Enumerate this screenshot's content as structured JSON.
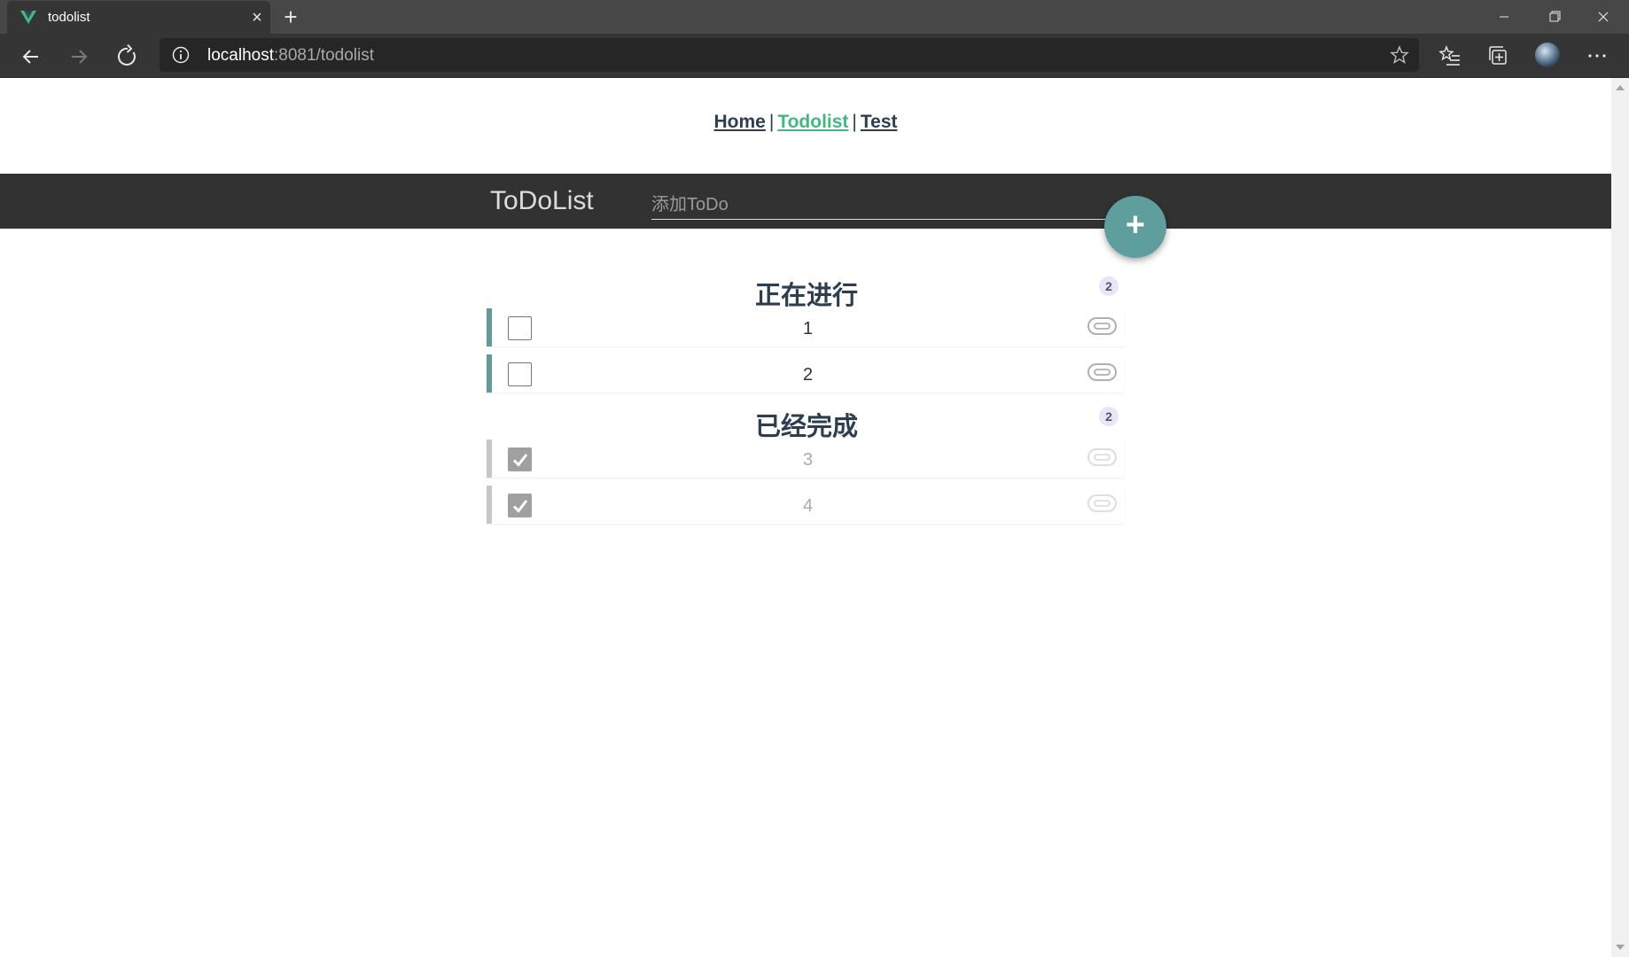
{
  "browser": {
    "tab_title": "todolist",
    "url_host": "localhost",
    "url_rest": ":8081/todolist"
  },
  "nav": {
    "links": [
      "Home",
      "Todolist",
      "Test"
    ],
    "separator": "|"
  },
  "header": {
    "title": "ToDoList",
    "input_placeholder": "添加ToDo",
    "input_value": "",
    "add_label": "+"
  },
  "sections": {
    "in_progress": {
      "title": "正在进行",
      "count": "2",
      "items": [
        {
          "text": "1",
          "done": false
        },
        {
          "text": "2",
          "done": false
        }
      ]
    },
    "completed": {
      "title": "已经完成",
      "count": "2",
      "items": [
        {
          "text": "3",
          "done": true
        },
        {
          "text": "4",
          "done": true
        }
      ]
    }
  },
  "colors": {
    "accent": "#629a9a",
    "fab": "#5e9e9c",
    "active_link": "#42b983",
    "header_bg": "#323232",
    "done_border": "#c7c7c7"
  }
}
